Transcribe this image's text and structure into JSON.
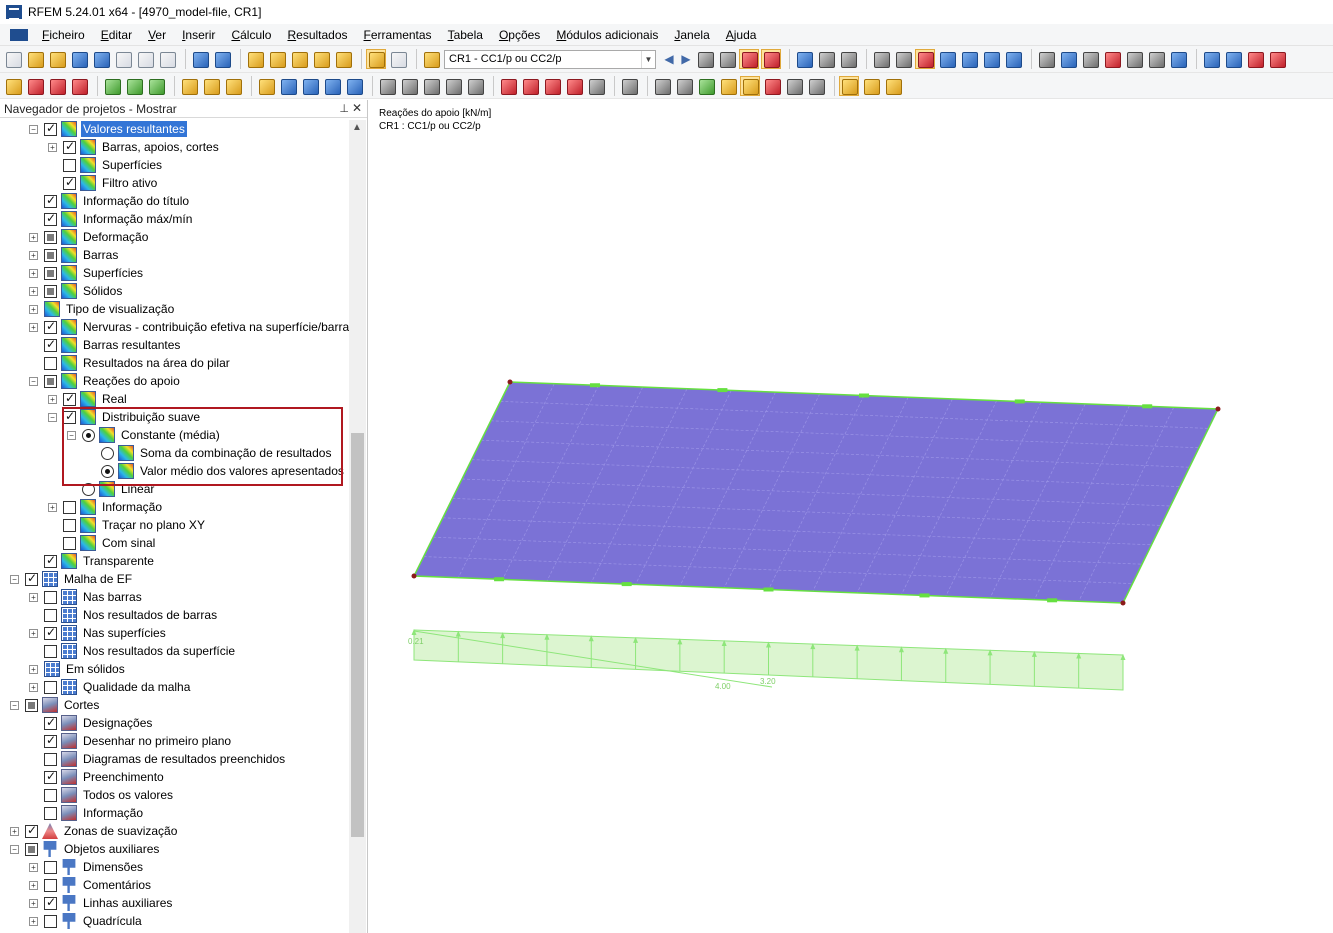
{
  "window": {
    "title": "RFEM 5.24.01 x64 - [4970_model-file, CR1]"
  },
  "menu": {
    "items": [
      "Ficheiro",
      "Editar",
      "Ver",
      "Inserir",
      "Cálculo",
      "Resultados",
      "Ferramentas",
      "Tabela",
      "Opções",
      "Módulos adicionais",
      "Janela",
      "Ajuda"
    ]
  },
  "toolbar": {
    "load_case_combo": "CR1 - CC1/p ou CC2/p"
  },
  "navigator": {
    "title": "Navegador de projetos - Mostrar",
    "items": [
      {
        "label": "Valores resultantes",
        "check": "checked",
        "expander": "minus",
        "icon": "result",
        "selected": true
      },
      {
        "label": "Barras, apoios, cortes",
        "check": "checked",
        "expander": "plus",
        "icon": "result"
      },
      {
        "label": "Superfícies",
        "check": "unchecked",
        "expander": "none",
        "icon": "result"
      },
      {
        "label": "Filtro ativo",
        "check": "checked",
        "expander": "none",
        "icon": "result"
      },
      {
        "label": "Informação do título",
        "check": "checked",
        "expander": "none",
        "icon": "result"
      },
      {
        "label": "Informação máx/mín",
        "check": "checked",
        "expander": "none",
        "icon": "result"
      },
      {
        "label": "Deformação",
        "check": "partial",
        "expander": "plus",
        "icon": "result"
      },
      {
        "label": "Barras",
        "check": "partial",
        "expander": "plus",
        "icon": "result"
      },
      {
        "label": "Superfícies",
        "check": "partial",
        "expander": "plus",
        "icon": "result"
      },
      {
        "label": "Sólidos",
        "check": "partial",
        "expander": "plus",
        "icon": "result"
      },
      {
        "label": "Tipo de visualização",
        "check": "none",
        "expander": "plus",
        "icon": "result"
      },
      {
        "label": "Nervuras - contribuição efetiva na superfície/barra",
        "check": "checked",
        "expander": "plus",
        "icon": "result"
      },
      {
        "label": "Barras resultantes",
        "check": "checked",
        "expander": "none",
        "icon": "result"
      },
      {
        "label": "Resultados na área do pilar",
        "check": "unchecked",
        "expander": "none",
        "icon": "result"
      },
      {
        "label": "Reações do apoio",
        "check": "partial",
        "expander": "minus",
        "icon": "result"
      },
      {
        "label": "Real",
        "check": "checked",
        "expander": "plus",
        "icon": "result"
      },
      {
        "label": "Distribuição suave",
        "check": "checked",
        "expander": "minus",
        "icon": "result"
      },
      {
        "label": "Constante (média)",
        "check": "radio-checked",
        "expander": "minus",
        "icon": "result"
      },
      {
        "label": "Soma da combinação de resultados",
        "check": "radio",
        "expander": "none",
        "icon": "result"
      },
      {
        "label": "Valor médio dos valores apresentados",
        "check": "radio-checked",
        "expander": "none",
        "icon": "result"
      },
      {
        "label": "Linear",
        "check": "radio",
        "expander": "none",
        "icon": "result"
      },
      {
        "label": "Informação",
        "check": "unchecked",
        "expander": "plus",
        "icon": "result"
      },
      {
        "label": "Traçar no plano XY",
        "check": "unchecked",
        "expander": "none",
        "icon": "result"
      },
      {
        "label": "Com sinal",
        "check": "unchecked",
        "expander": "none",
        "icon": "result"
      },
      {
        "label": "Transparente",
        "check": "checked",
        "expander": "none",
        "icon": "result"
      },
      {
        "label": "Malha de EF",
        "check": "checked",
        "expander": "minus",
        "icon": "mesh"
      },
      {
        "label": "Nas barras",
        "check": "unchecked",
        "expander": "plus",
        "icon": "mesh"
      },
      {
        "label": "Nos resultados de barras",
        "check": "unchecked",
        "expander": "none",
        "icon": "mesh"
      },
      {
        "label": "Nas superfícies",
        "check": "checked",
        "expander": "plus",
        "icon": "mesh"
      },
      {
        "label": "Nos resultados da superfície",
        "check": "unchecked",
        "expander": "none",
        "icon": "mesh"
      },
      {
        "label": "Em sólidos",
        "check": "none",
        "expander": "plus",
        "icon": "mesh"
      },
      {
        "label": "Qualidade da malha",
        "check": "unchecked",
        "expander": "plus",
        "icon": "mesh"
      },
      {
        "label": "Cortes",
        "check": "partial",
        "expander": "minus",
        "icon": "section"
      },
      {
        "label": "Designações",
        "check": "checked",
        "expander": "none",
        "icon": "section"
      },
      {
        "label": "Desenhar no primeiro plano",
        "check": "checked",
        "expander": "none",
        "icon": "section"
      },
      {
        "label": "Diagramas de resultados preenchidos",
        "check": "unchecked",
        "expander": "none",
        "icon": "section"
      },
      {
        "label": "Preenchimento",
        "check": "checked",
        "expander": "none",
        "icon": "section"
      },
      {
        "label": "Todos os valores",
        "check": "unchecked",
        "expander": "none",
        "icon": "section"
      },
      {
        "label": "Informação",
        "check": "unchecked",
        "expander": "none",
        "icon": "section"
      },
      {
        "label": "Zonas de suavização",
        "check": "checked",
        "expander": "plus",
        "icon": "smooth"
      },
      {
        "label": "Objetos auxiliares",
        "check": "partial",
        "expander": "minus",
        "icon": "helper"
      },
      {
        "label": "Dimensões",
        "check": "unchecked",
        "expander": "plus",
        "icon": "helper"
      },
      {
        "label": "Comentários",
        "check": "unchecked",
        "expander": "plus",
        "icon": "helper"
      },
      {
        "label": "Linhas auxiliares",
        "check": "checked",
        "expander": "plus",
        "icon": "helper"
      },
      {
        "label": "Quadrícula",
        "check": "unchecked",
        "expander": "plus",
        "icon": "helper"
      }
    ]
  },
  "viewport": {
    "info_line1": "Reações do apoio [kN/m]",
    "info_line2": "CR1 : CC1/p ou CC2/p",
    "diagram_labels": [
      "0.21",
      "4.00",
      "3.20"
    ],
    "colors": {
      "plate": "#7b72d6",
      "edge": "#66e040",
      "diagram_fill": "#dcf5d0",
      "diagram_line": "#8ee67a",
      "node": "#8b1a1a",
      "highlight": "#b01820",
      "selection": "#3375d6"
    }
  }
}
